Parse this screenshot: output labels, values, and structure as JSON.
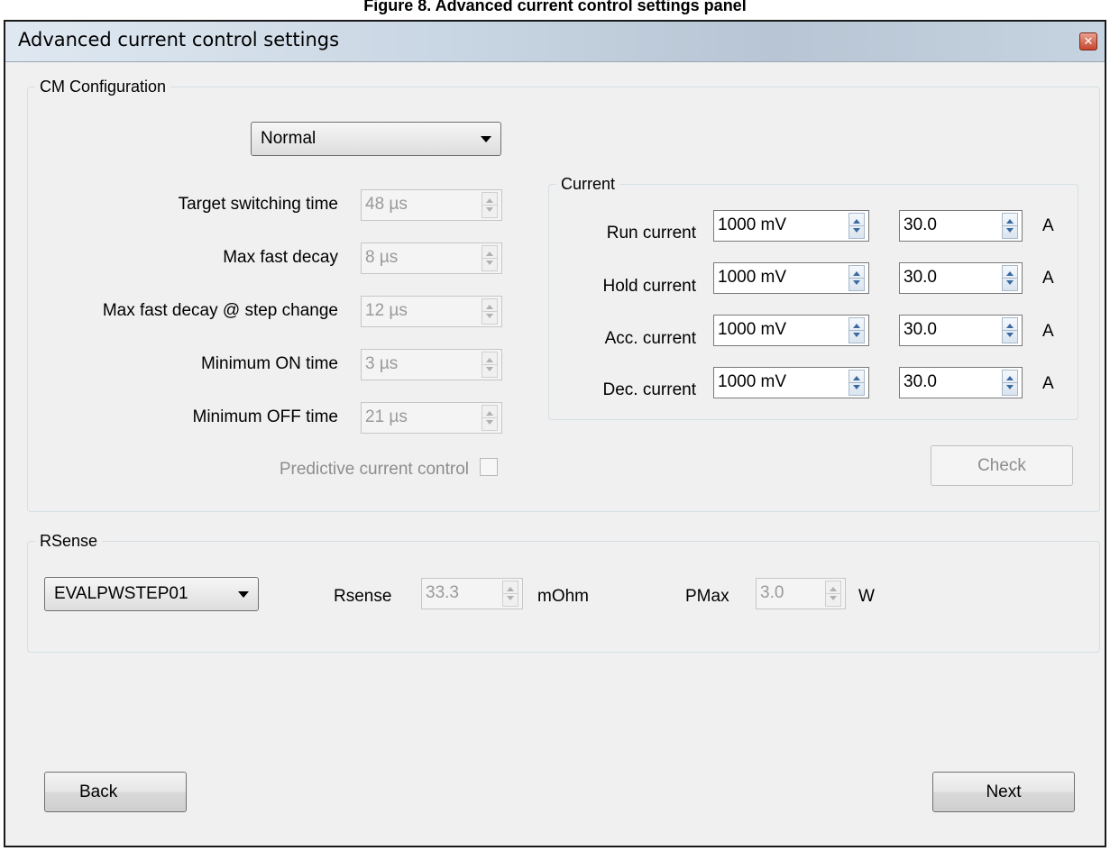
{
  "figure_caption": "Figure 8. Advanced current control settings panel",
  "window": {
    "title": "Advanced current control settings"
  },
  "cm_config": {
    "group_label": "CM Configuration",
    "mode_selected": "Normal",
    "timing": [
      {
        "label": "Target switching time",
        "value": "48 µs"
      },
      {
        "label": "Max fast decay",
        "value": "8 µs"
      },
      {
        "label": "Max fast decay @ step change",
        "value": "12 µs"
      },
      {
        "label": "Minimum ON time",
        "value": "3 µs"
      },
      {
        "label": "Minimum OFF time",
        "value": "21 µs"
      }
    ],
    "predictive_label": "Predictive current control",
    "current": {
      "group_label": "Current",
      "unit": "A",
      "rows": [
        {
          "label": "Run current",
          "mv": "1000 mV",
          "amps": "30.0"
        },
        {
          "label": "Hold current",
          "mv": "1000 mV",
          "amps": "30.0"
        },
        {
          "label": "Acc. current",
          "mv": "1000 mV",
          "amps": "30.0"
        },
        {
          "label": "Dec. current",
          "mv": "1000 mV",
          "amps": "30.0"
        }
      ]
    },
    "check_label": "Check"
  },
  "rsense": {
    "group_label": "RSense",
    "board_selected": "EVALPWSTEP01",
    "rsense_label": "Rsense",
    "rsense_value": "33.3",
    "rsense_unit": "mOhm",
    "pmax_label": "PMax",
    "pmax_value": "3.0",
    "pmax_unit": "W"
  },
  "nav": {
    "back_label": "Back",
    "next_label": "Next"
  }
}
